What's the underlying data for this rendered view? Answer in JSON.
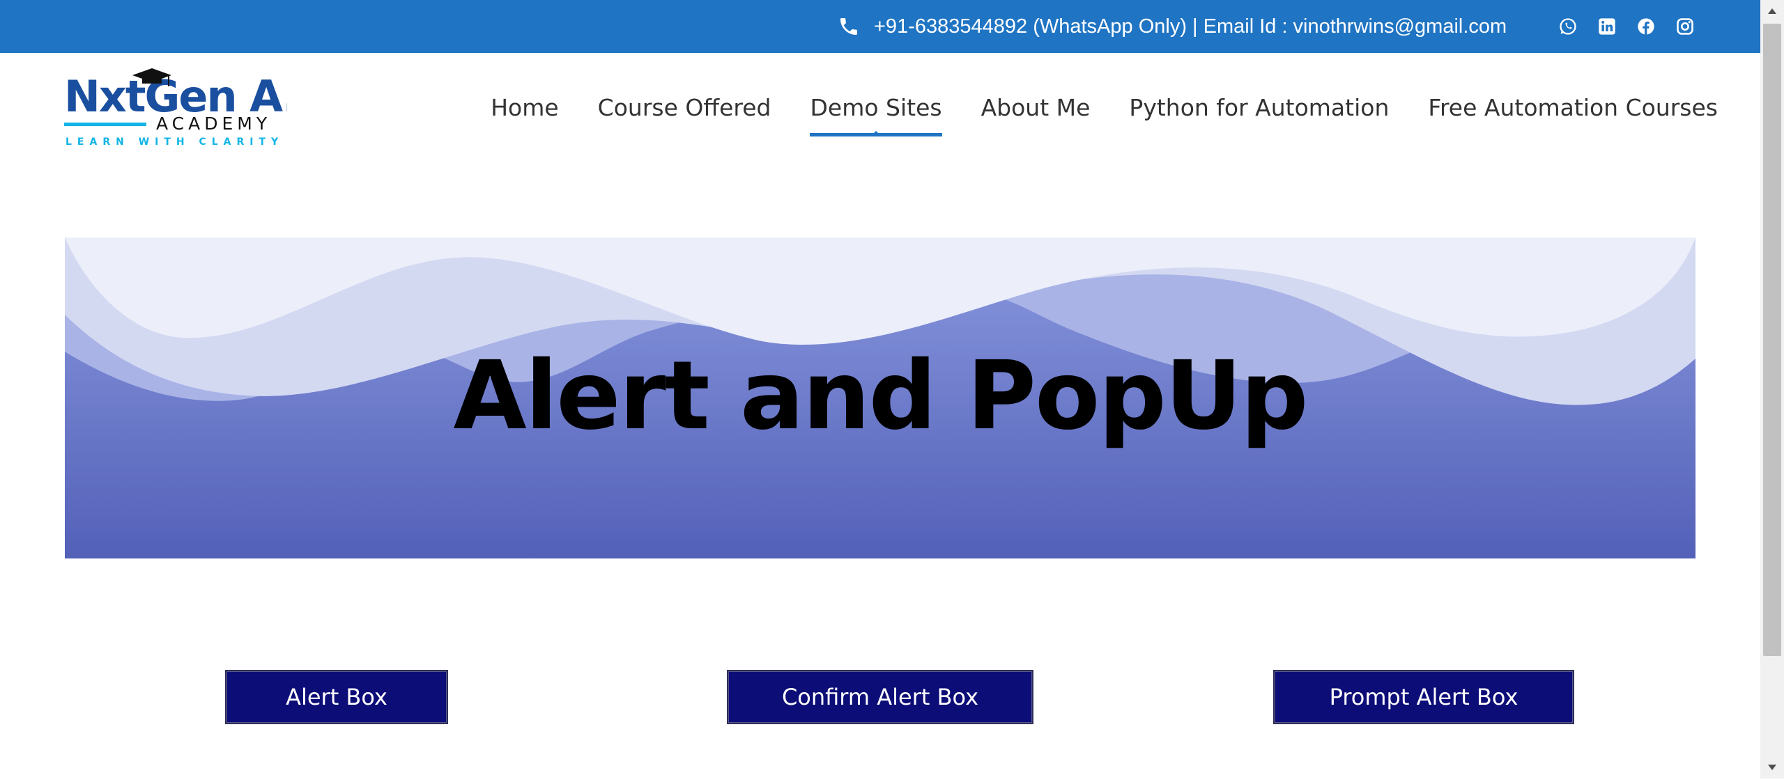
{
  "topbar": {
    "contact_text": "+91-6383544892 (WhatsApp Only) | Email Id : vinothrwins@gmail.com",
    "icons": [
      "phone-icon",
      "whatsapp-icon",
      "linkedin-icon",
      "facebook-icon",
      "instagram-icon"
    ]
  },
  "logo": {
    "brand": "NxtGen A.I",
    "sub": "ACADEMY",
    "tagline": "LEARN WITH CLARITY"
  },
  "nav": {
    "items": [
      "Home",
      "Course Offered",
      "Demo Sites",
      "About Me",
      "Python for Automation",
      "Free Automation Courses"
    ],
    "active": "Demo Sites"
  },
  "hero": {
    "title": "Alert and PopUp"
  },
  "buttons": {
    "alert": "Alert Box",
    "confirm": "Confirm Alert Box",
    "prompt": "Prompt Alert Box"
  },
  "colors": {
    "topbar": "#1f74c3",
    "button": "#0d0d78",
    "hero_gradient_top": "#8a99df",
    "hero_gradient_bottom": "#5360b8",
    "logo_blue": "#1a4fa0",
    "logo_cyan": "#13b5e6"
  }
}
